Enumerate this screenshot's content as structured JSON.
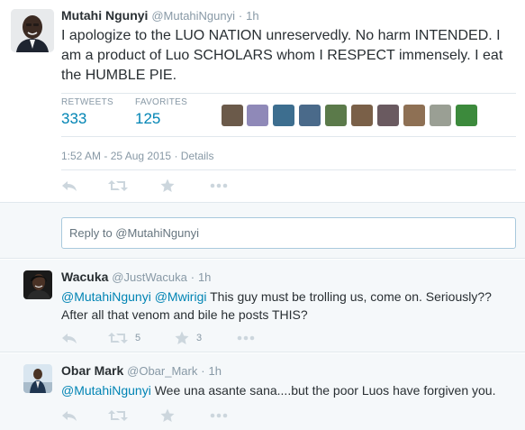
{
  "main_tweet": {
    "author_name": "Mutahi Ngunyi",
    "author_handle": "@MutahiNgunyi",
    "separator": "·",
    "time_ago": "1h",
    "text": "I apologize to the LUO NATION unreservedly. No harm INTENDED. I am a product of Luo SCHOLARS whom I RESPECT immensely. I eat the HUMBLE PIE.",
    "retweets_label": "RETWEETS",
    "retweets_count": "333",
    "favorites_label": "FAVORITES",
    "favorites_count": "125",
    "timestamp": "1:52 AM - 25 Aug 2015",
    "details_separator": "·",
    "details_link": "Details",
    "favoriter_colors": [
      "#6b5a4a",
      "#8f89b8",
      "#3d6e8f",
      "#4a6a8a",
      "#5b7a4a",
      "#7a6048",
      "#6a5a60",
      "#8e7054",
      "#9a9f94",
      "#3c8a3c"
    ]
  },
  "reply_box": {
    "placeholder": "Reply to @MutahiNgunyi"
  },
  "replies": [
    {
      "author_name": "Wacuka",
      "author_handle": "@JustWacuka",
      "separator": "·",
      "time_ago": "1h",
      "mention1": "@MutahiNgunyi",
      "mention2": "@Mwirigi",
      "text": "This guy must be trolling us, come on. Seriously?? After all that venom and bile he posts THIS?",
      "retweet_count": "5",
      "favorite_count": "3"
    },
    {
      "author_name": "Obar Mark",
      "author_handle": "@Obar_Mark",
      "separator": "·",
      "time_ago": "1h",
      "mention1": "@MutahiNgunyi",
      "text": "Wee una asante sana....but the poor Luos have forgiven you."
    }
  ],
  "colors": {
    "link": "#0084b4",
    "muted": "#8899a6",
    "icon": "#ccd6dd",
    "reply_bg": "#f5f8fa"
  }
}
